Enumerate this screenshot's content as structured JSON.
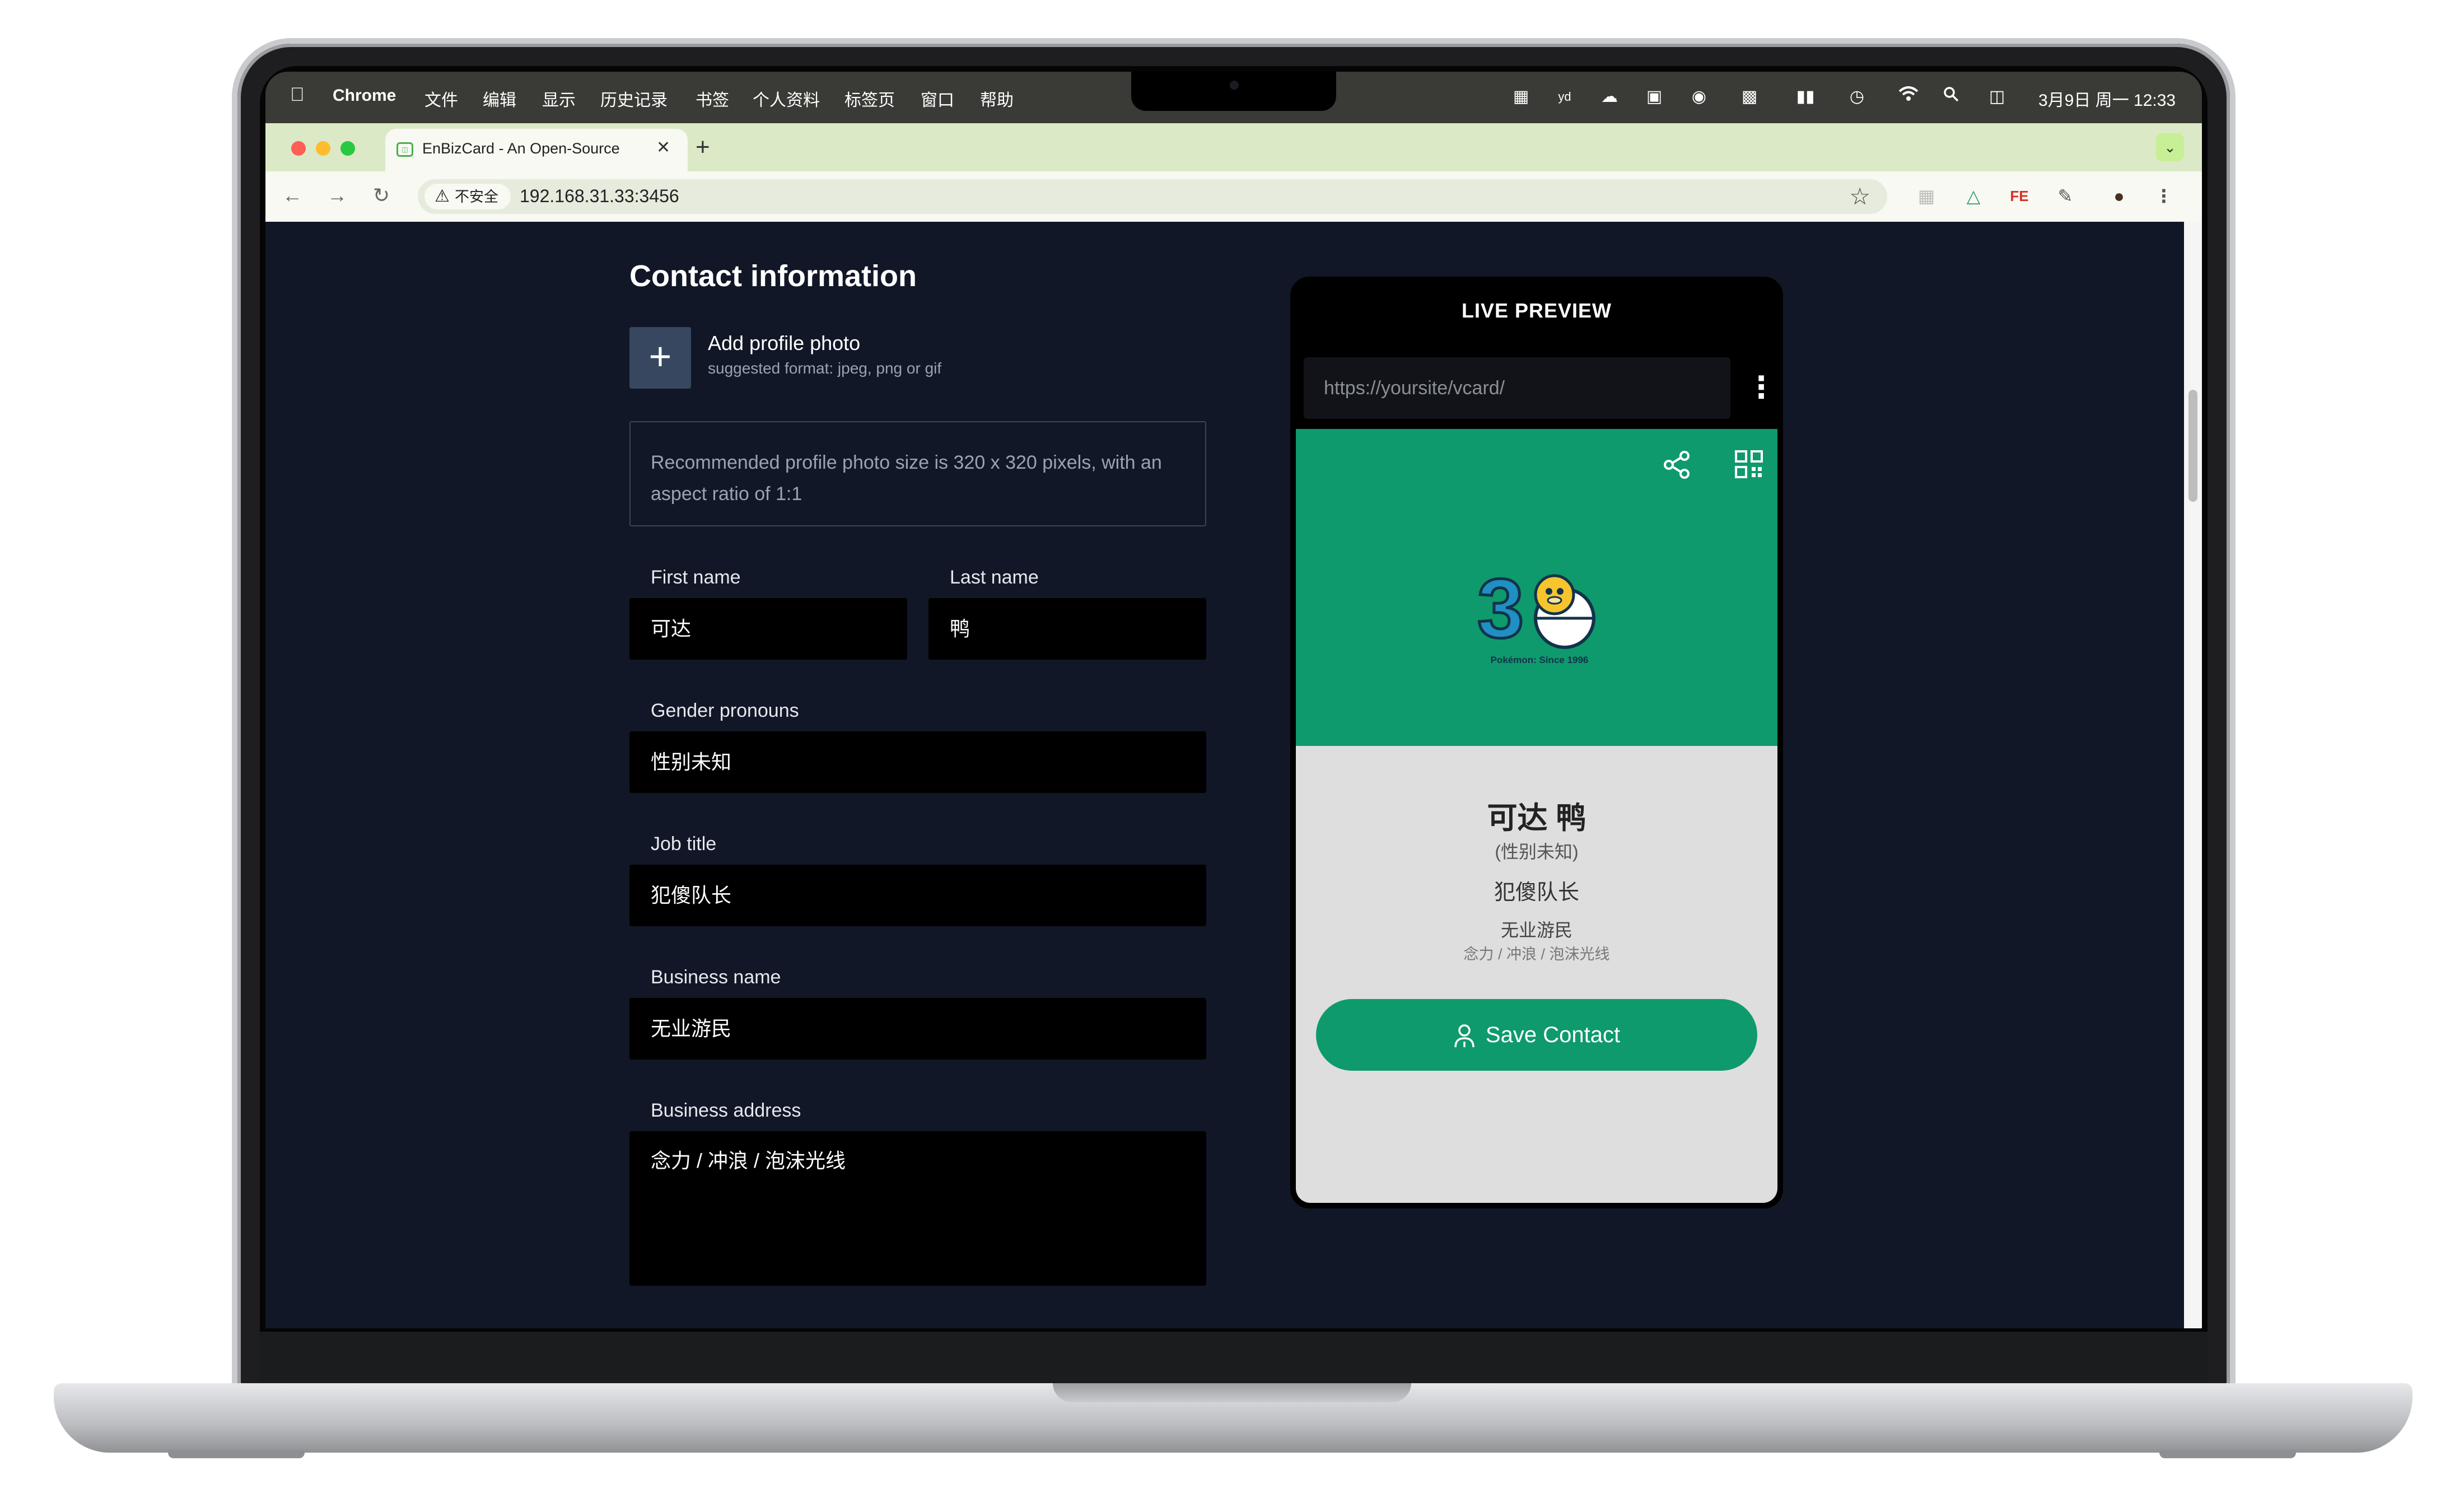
{
  "menubar": {
    "app": "Chrome",
    "menus": [
      "文件",
      "编辑",
      "显示",
      "历史记录",
      "书签",
      "个人资料",
      "标签页",
      "窗口",
      "帮助"
    ],
    "clock": "3月9日 周一 12:33"
  },
  "browser": {
    "tab_title": "EnBizCard - An Open-Source",
    "insecure_label": "不安全",
    "url": "192.168.31.33:3456"
  },
  "form": {
    "heading": "Contact information",
    "add_photo_label": "Add profile photo",
    "add_photo_hint": "suggested format: jpeg, png or gif",
    "photo_note": "Recommended profile photo size is 320 x 320 pixels, with an aspect ratio of 1:1",
    "first_name_label": "First name",
    "first_name": "可达",
    "last_name_label": "Last name",
    "last_name": "鸭",
    "pronouns_label": "Gender pronouns",
    "pronouns": "性别未知",
    "job_label": "Job title",
    "job": "犯傻队长",
    "business_label": "Business name",
    "business": "无业游民",
    "address_label": "Business address",
    "address": "念力 / 冲浪 / 泡沫光线"
  },
  "preview": {
    "title": "LIVE PREVIEW",
    "url_placeholder": "https://yoursite/vcard/",
    "name": "可达 鸭",
    "pronouns": "(性别未知)",
    "job": "犯傻队长",
    "business": "无业游民",
    "address": "念力 / 冲浪 / 泡沫光线",
    "save_label": "Save Contact",
    "logo_text": "Pokémon: Since 1996",
    "brand_color": "#0e9a6c"
  },
  "icons": {
    "menubar": [
      "apple-icon",
      "wifi-icon",
      "search-icon",
      "control-center-icon"
    ],
    "toolbar": [
      "back-icon",
      "forward-icon",
      "reload-icon",
      "bookmark-star-icon",
      "extensions-icon",
      "menu-icon"
    ]
  }
}
